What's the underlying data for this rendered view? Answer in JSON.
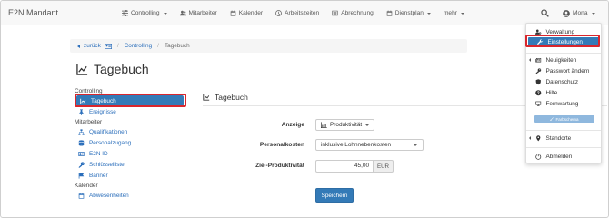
{
  "app": {
    "brand": "E2N Mandant"
  },
  "topnav": {
    "items": [
      {
        "label": "Controlling",
        "icon": "sliders-icon",
        "has_caret": true
      },
      {
        "label": "Mitarbeiter",
        "icon": "users-icon",
        "has_caret": false
      },
      {
        "label": "Kalender",
        "icon": "calendar-icon",
        "has_caret": false
      },
      {
        "label": "Arbeitszeiten",
        "icon": "clock-icon",
        "has_caret": false
      },
      {
        "label": "Abrechnung",
        "icon": "list-icon",
        "has_caret": false
      },
      {
        "label": "Dienstplan",
        "icon": "calendar-icon",
        "has_caret": true
      },
      {
        "label": "mehr",
        "icon": "",
        "has_caret": true
      }
    ],
    "user": "Mona"
  },
  "breadcrumb": {
    "back_label": "zurück",
    "items": [
      "Controlling",
      "Tagebuch"
    ]
  },
  "page": {
    "title": "Tagebuch"
  },
  "sidebar": {
    "groups": [
      {
        "label": "Controlling",
        "items": [
          {
            "label": "Tagebuch",
            "icon": "chart-line-icon",
            "active": true
          },
          {
            "label": "Ereignisse",
            "icon": "pin-icon",
            "active": false
          }
        ]
      },
      {
        "label": "Mitarbeiter",
        "items": [
          {
            "label": "Qualifikationen",
            "icon": "sitemap-icon",
            "active": false
          },
          {
            "label": "Personalzugang",
            "icon": "database-icon",
            "active": false
          },
          {
            "label": "E2N ID",
            "icon": "id-card-icon",
            "active": false
          },
          {
            "label": "Schlüsselliste",
            "icon": "key-icon",
            "active": false
          },
          {
            "label": "Banner",
            "icon": "flag-icon",
            "active": false
          }
        ]
      },
      {
        "label": "Kalender",
        "items": [
          {
            "label": "Abwesenheiten",
            "icon": "calendar-icon",
            "active": false
          }
        ]
      }
    ]
  },
  "content": {
    "title": "Tagebuch",
    "form": {
      "anzeige_label": "Anzeige",
      "anzeige_value": "Produktivität",
      "personalkosten_label": "Personalkosten",
      "personalkosten_value": "inklusive Lohnnebenkosten",
      "zielproduktivitaet_label": "Ziel-Produktivität",
      "zielproduktivitaet_value": "45,00",
      "zielproduktivitaet_unit": "EUR",
      "save_label": "Speichern"
    }
  },
  "user_menu": {
    "items": [
      {
        "label": "Verwaltung",
        "icon": "users-cog-icon"
      },
      {
        "label": "Einstellungen",
        "icon": "wrench-icon",
        "active": true
      },
      {
        "label": "Neuigkeiten",
        "icon": "news-icon"
      },
      {
        "label": "Passwort ändern",
        "icon": "key-icon"
      },
      {
        "label": "Datenschutz",
        "icon": "shield-icon"
      },
      {
        "label": "Hilfe",
        "icon": "question-icon"
      },
      {
        "label": "Fernwartung",
        "icon": "monitor-icon"
      },
      {
        "label": "Farbschema",
        "icon": "brush-icon"
      },
      {
        "label": "Standorte",
        "icon": "map-marker-icon"
      },
      {
        "label": "Abmelden",
        "icon": "power-icon"
      }
    ]
  },
  "colors": {
    "primary": "#337ab7",
    "highlight": "#d9262c",
    "link": "#2a6ebb"
  }
}
